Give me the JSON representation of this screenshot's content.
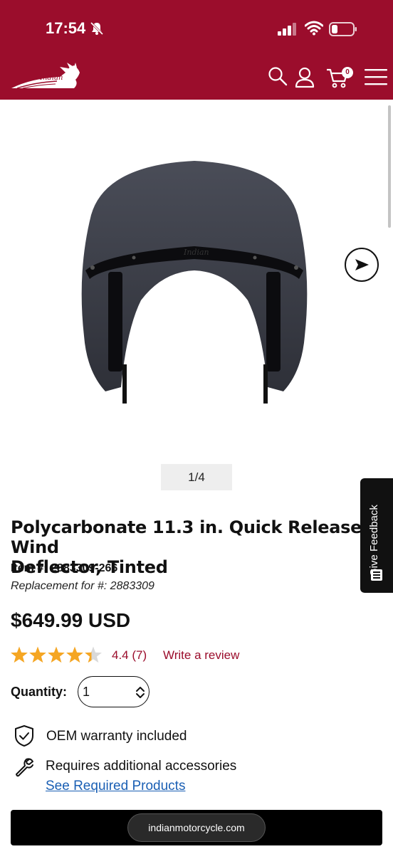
{
  "status_bar": {
    "time": "17:54"
  },
  "header": {
    "brand": "Indian Motorcycle",
    "cart_count": "0",
    "icons": [
      "search-icon",
      "account-icon",
      "cart-icon",
      "menu-icon"
    ]
  },
  "gallery": {
    "pager": "1/4"
  },
  "feedback_tab": {
    "label": "Give Feedback"
  },
  "product": {
    "title": "Polycarbonate 11.3 in. Quick Release Wind\nDeflector, Tinted",
    "item_number": "Item #: 2883309-266",
    "replacement": "Replacement for #: 2883309",
    "price": "$649.99 USD",
    "rating": {
      "score": 4.4,
      "label": "4.4 (7)",
      "max": 5
    },
    "write_review": "Write a review",
    "quantity": {
      "label": "Quantity:",
      "value": "1"
    },
    "features": [
      {
        "icon": "shield-check-icon",
        "text": "OEM warranty included"
      },
      {
        "icon": "wrench-icon",
        "text": "Requires additional accessories",
        "link": "See Required Products"
      }
    ]
  },
  "browser": {
    "url": "indianmotorcycle.com"
  },
  "colors": {
    "brand": "#9b0d2c",
    "star": "#f5a623",
    "link": "#1a5fb4"
  }
}
